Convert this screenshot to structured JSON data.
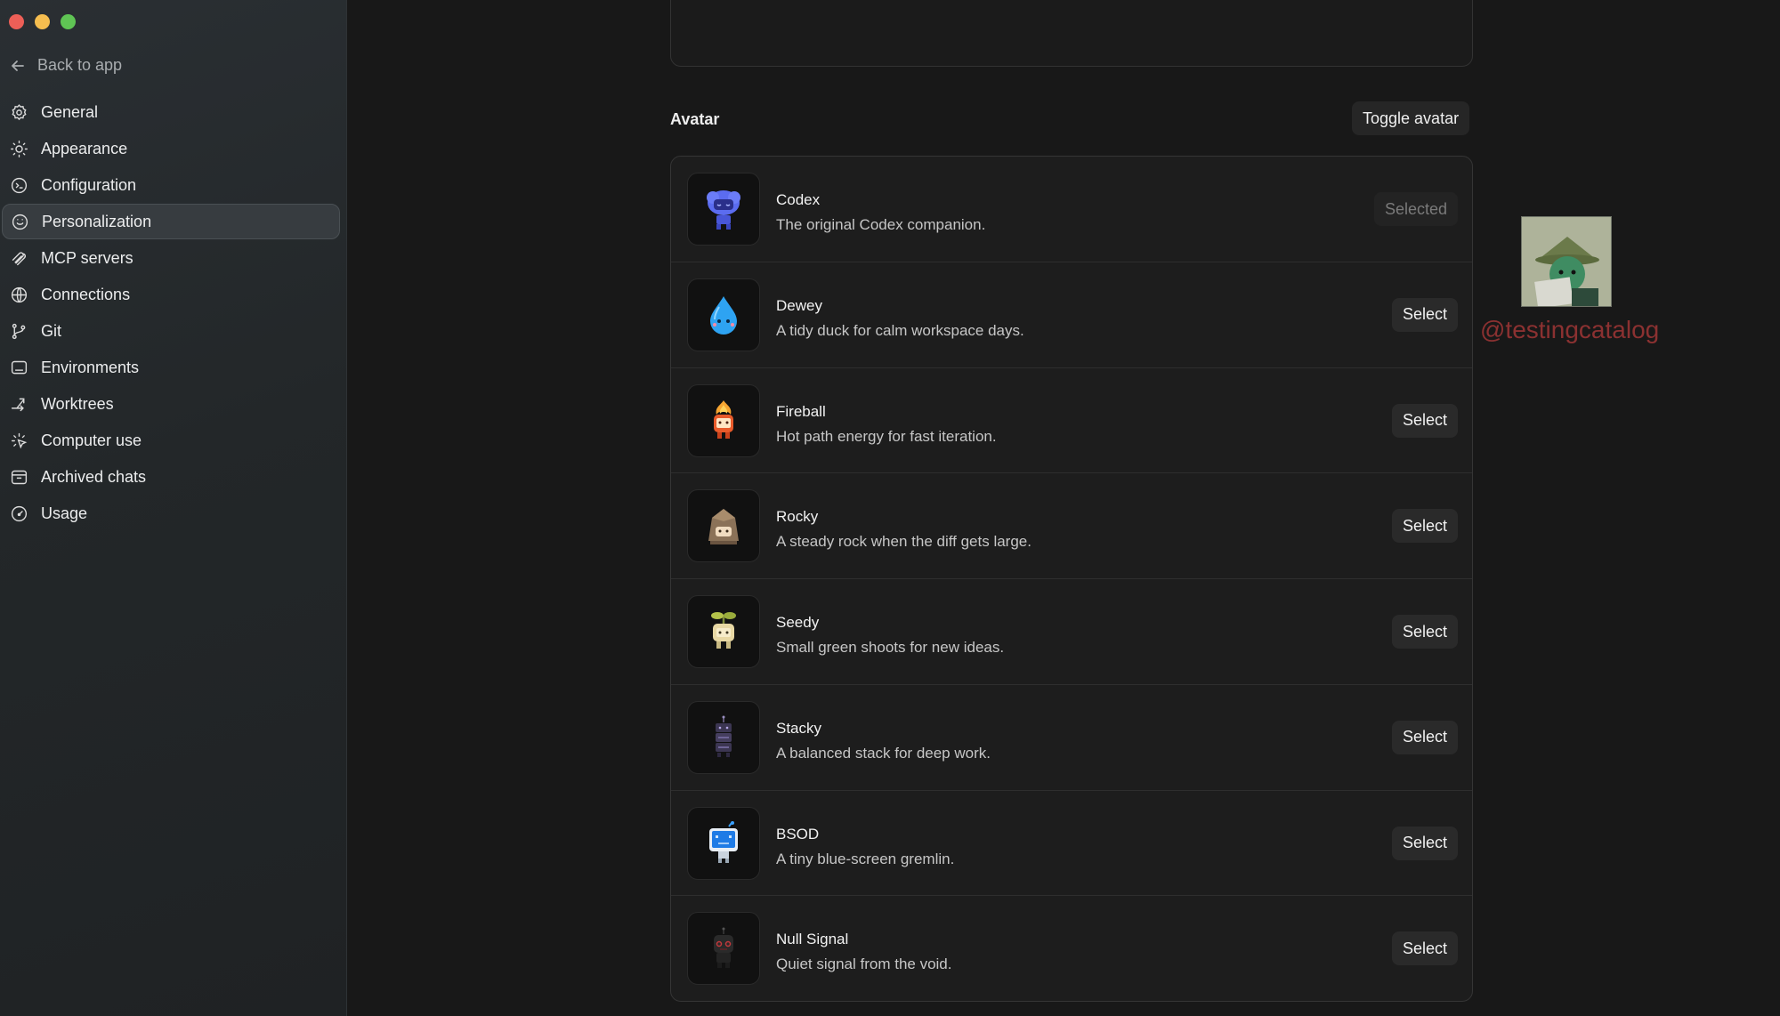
{
  "sidebar": {
    "back_label": "Back to app",
    "items": [
      {
        "label": "General",
        "icon": "gear-icon"
      },
      {
        "label": "Appearance",
        "icon": "sun-icon"
      },
      {
        "label": "Configuration",
        "icon": "terminal-icon"
      },
      {
        "label": "Personalization",
        "icon": "smiley-icon"
      },
      {
        "label": "MCP servers",
        "icon": "plug-icon"
      },
      {
        "label": "Connections",
        "icon": "globe-icon"
      },
      {
        "label": "Git",
        "icon": "branch-icon"
      },
      {
        "label": "Environments",
        "icon": "monitor-icon"
      },
      {
        "label": "Worktrees",
        "icon": "fork-icon"
      },
      {
        "label": "Computer use",
        "icon": "cursor-icon"
      },
      {
        "label": "Archived chats",
        "icon": "archive-icon"
      },
      {
        "label": "Usage",
        "icon": "gauge-icon"
      }
    ],
    "active": "Personalization"
  },
  "avatar_section": {
    "title": "Avatar",
    "toggle_label": "Toggle avatar",
    "avatars": [
      {
        "name": "Codex",
        "desc": "The original Codex companion.",
        "button": "Selected",
        "selected": true,
        "icon": "robot-cloud-icon"
      },
      {
        "name": "Dewey",
        "desc": "A tidy duck for calm workspace days.",
        "button": "Select",
        "selected": false,
        "icon": "water-drop-icon"
      },
      {
        "name": "Fireball",
        "desc": "Hot path energy for fast iteration.",
        "button": "Select",
        "selected": false,
        "icon": "flame-icon"
      },
      {
        "name": "Rocky",
        "desc": "A steady rock when the diff gets large.",
        "button": "Select",
        "selected": false,
        "icon": "rock-icon"
      },
      {
        "name": "Seedy",
        "desc": "Small green shoots for new ideas.",
        "button": "Select",
        "selected": false,
        "icon": "sprout-icon"
      },
      {
        "name": "Stacky",
        "desc": "A balanced stack for deep work.",
        "button": "Select",
        "selected": false,
        "icon": "stack-icon"
      },
      {
        "name": "BSOD",
        "desc": "A tiny blue-screen gremlin.",
        "button": "Select",
        "selected": false,
        "icon": "blue-screen-icon"
      },
      {
        "name": "Null Signal",
        "desc": "Quiet signal from the void.",
        "button": "Select",
        "selected": false,
        "icon": "null-robot-icon"
      }
    ]
  },
  "watermark": {
    "text": "@testingcatalog"
  },
  "colors": {
    "background": "#181818",
    "sidebar": "#24282a",
    "watermark": "#b23a3a"
  }
}
